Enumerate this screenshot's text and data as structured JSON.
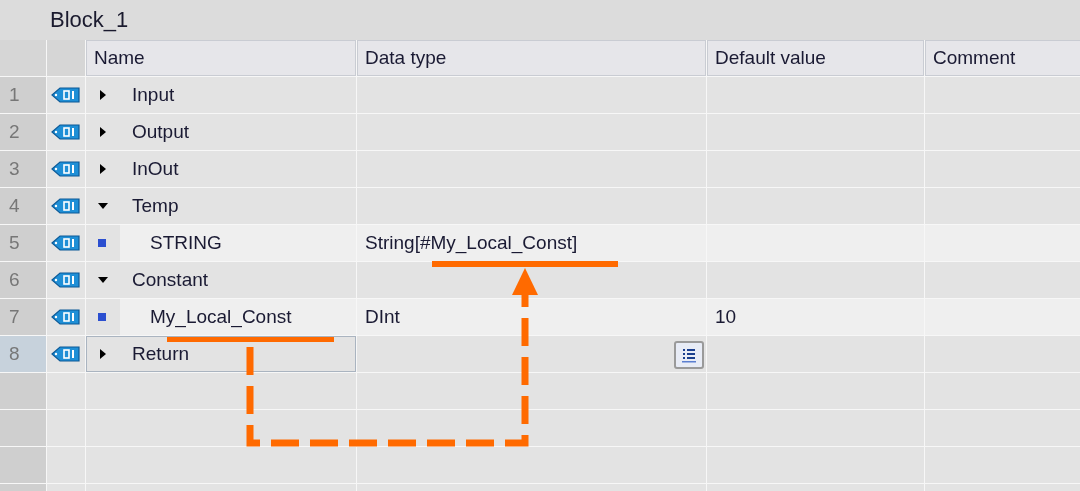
{
  "title": "Block_1",
  "columns": [
    "Name",
    "Data type",
    "Default value",
    "Comment"
  ],
  "rows": [
    {
      "number": "1",
      "kind": "section",
      "expanded": false,
      "name": "Input",
      "selected": false
    },
    {
      "number": "2",
      "kind": "section",
      "expanded": false,
      "name": "Output",
      "selected": false
    },
    {
      "number": "3",
      "kind": "section",
      "expanded": false,
      "name": "InOut",
      "selected": false
    },
    {
      "number": "4",
      "kind": "section",
      "expanded": true,
      "name": "Temp",
      "selected": false
    },
    {
      "number": "5",
      "kind": "member",
      "name": "STRING",
      "data_type": "String[#My_Local_Const]",
      "selected": false
    },
    {
      "number": "6",
      "kind": "section",
      "expanded": true,
      "name": "Constant",
      "selected": false
    },
    {
      "number": "7",
      "kind": "member",
      "name": "My_Local_Const",
      "data_type": "DInt",
      "default_value": "10",
      "selected": false
    },
    {
      "number": "8",
      "kind": "section",
      "expanded": false,
      "name": "Return",
      "selected": true
    }
  ]
}
